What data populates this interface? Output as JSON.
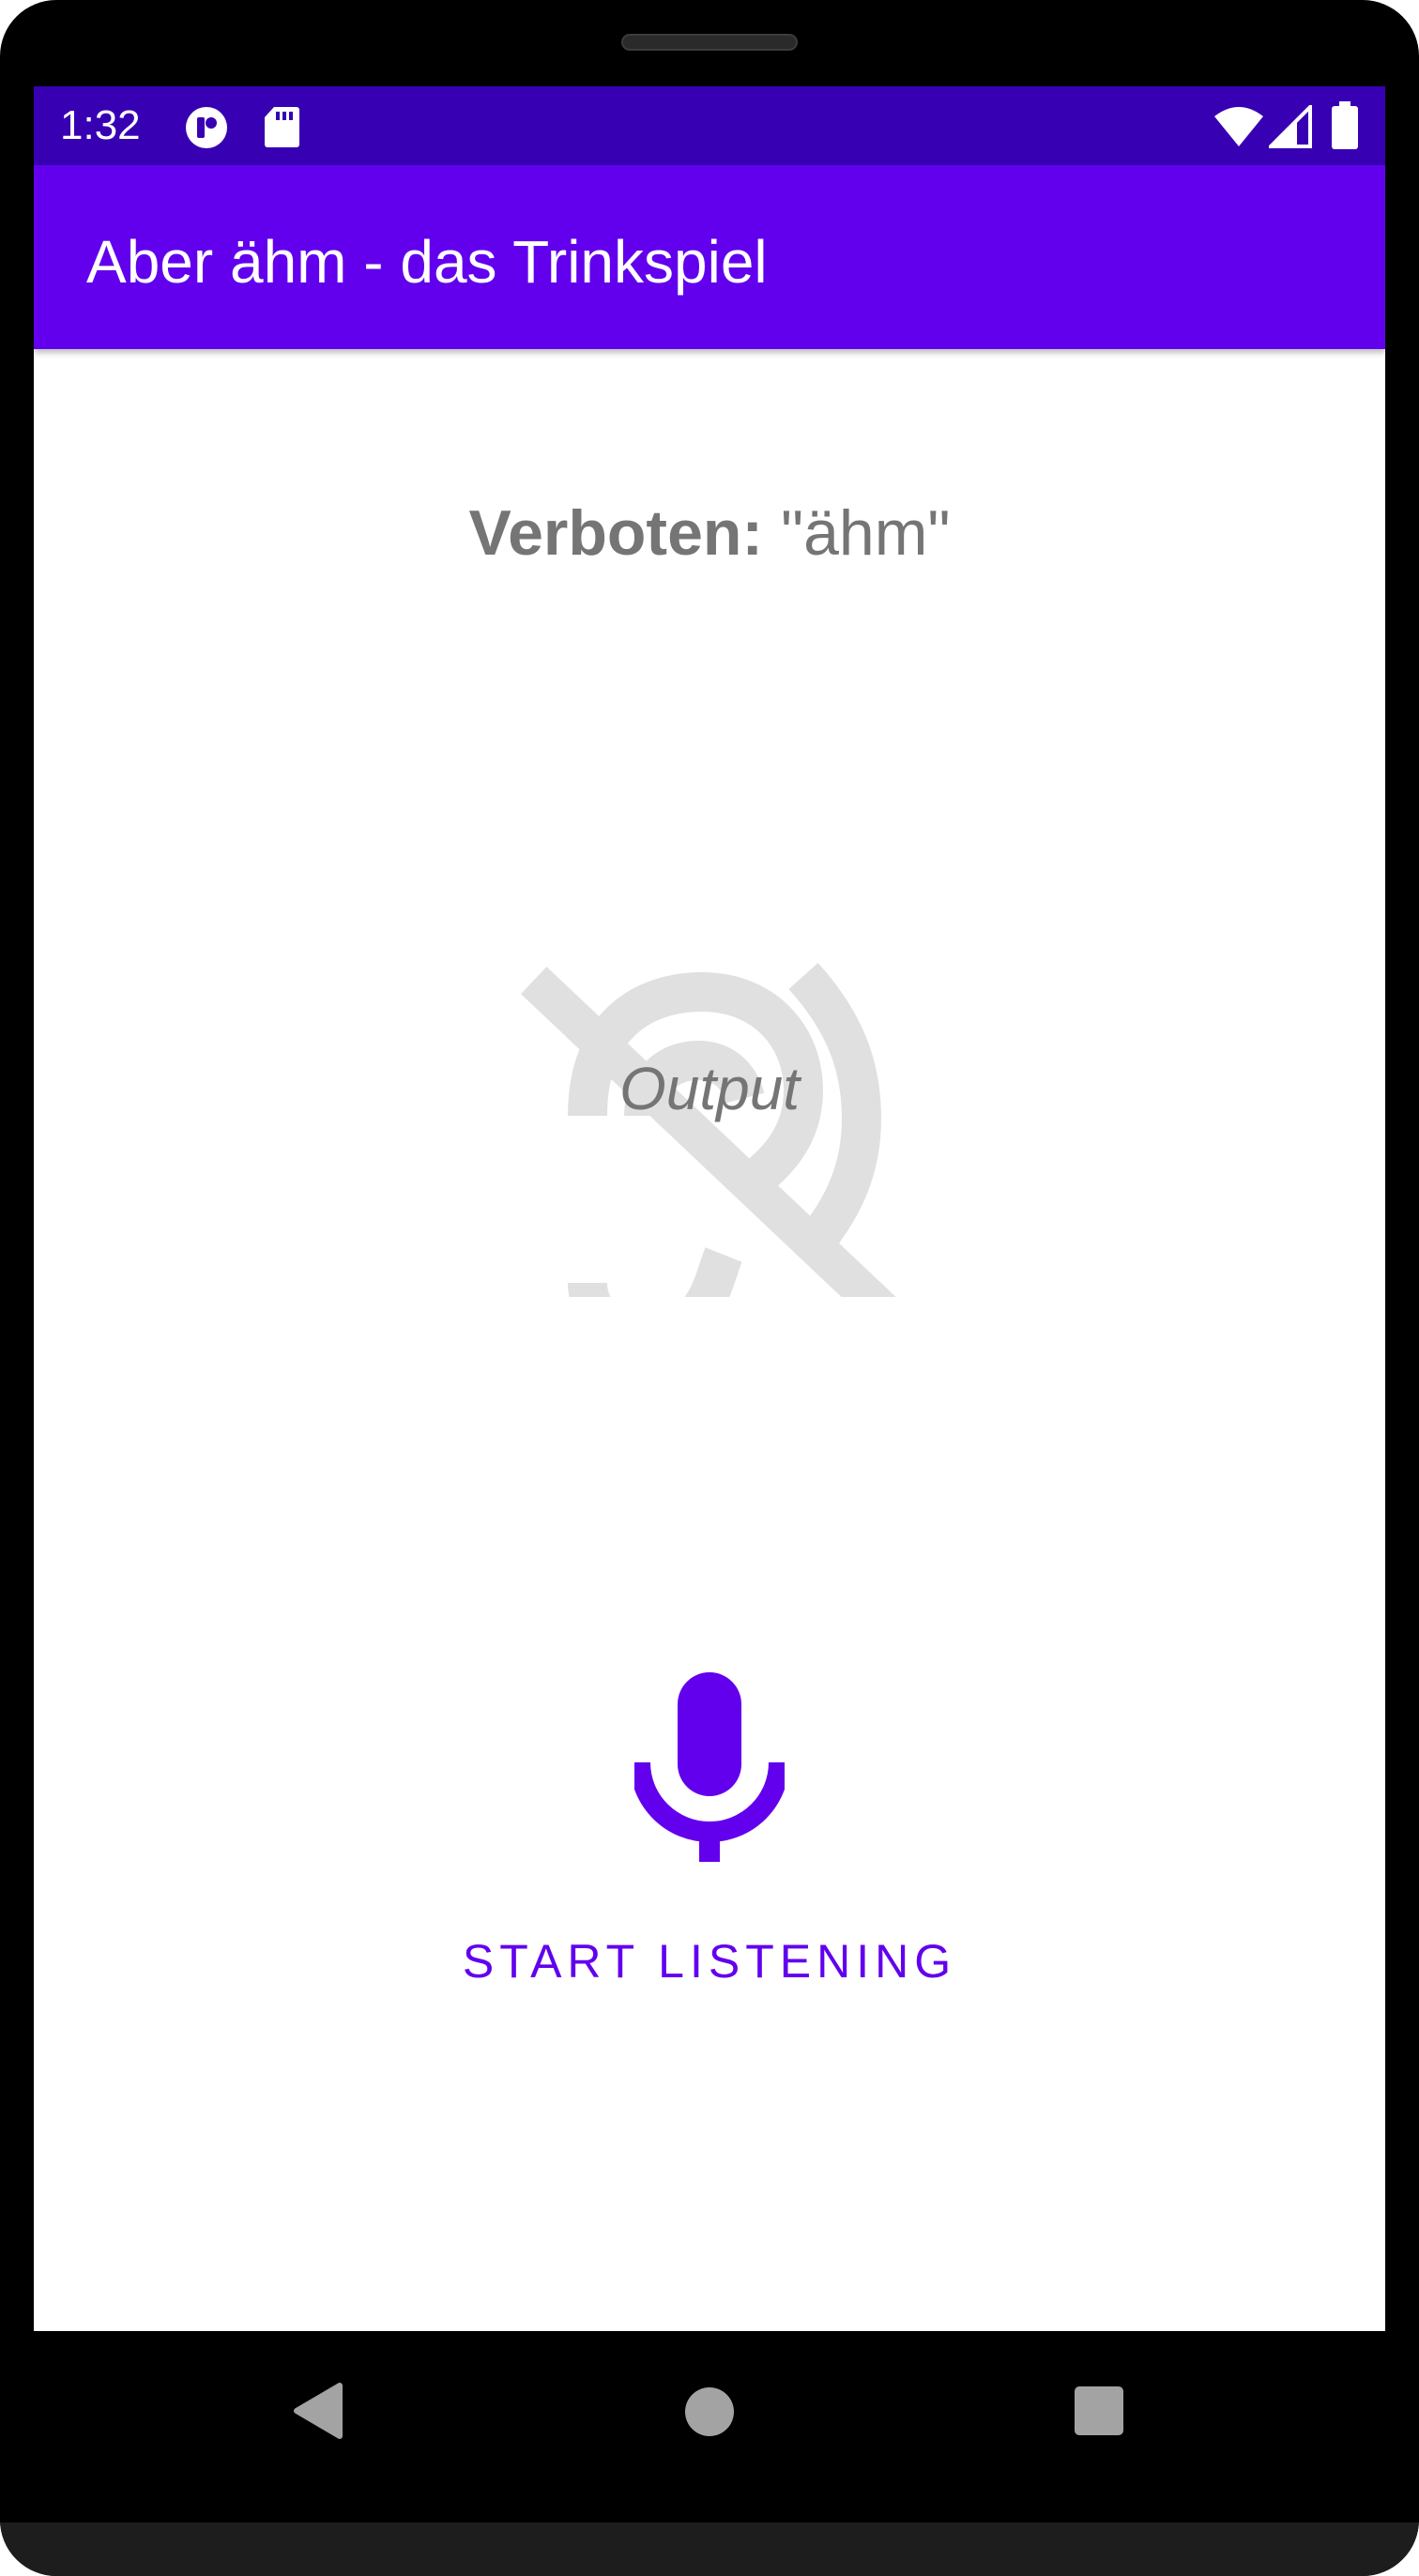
{
  "status_bar": {
    "time": "1:32",
    "icons": [
      "app-notification-icon",
      "sd-card-icon",
      "wifi-icon",
      "cell-signal-icon",
      "battery-icon"
    ],
    "background": "#3700b3"
  },
  "app_bar": {
    "title": "Aber ähm - das Trinkspiel",
    "background": "#6200ee"
  },
  "main": {
    "forbidden_label": "Verboten:",
    "forbidden_word": " \"ähm\"",
    "output_text": "Output",
    "hearing_icon": "hearing-disabled-icon",
    "mic_icon": "microphone-icon",
    "start_button_label": "START LISTENING",
    "accent_color": "#6200ee"
  },
  "nav_bar": {
    "buttons": [
      "back-icon",
      "home-icon",
      "recents-icon"
    ]
  }
}
